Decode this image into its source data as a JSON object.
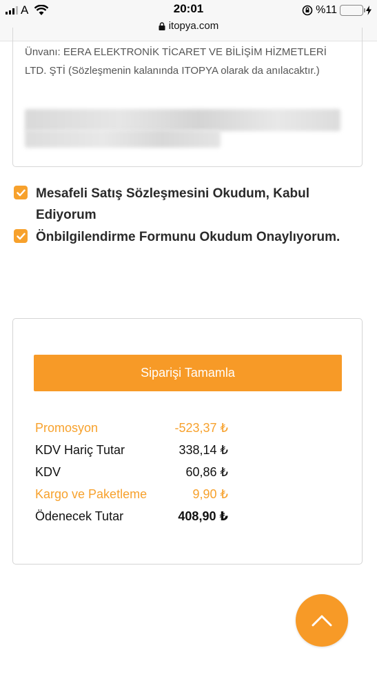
{
  "status_bar": {
    "carrier": "A",
    "time": "20:01",
    "battery_percent": "%11",
    "battery_level": 0.11,
    "url": "itopya.com"
  },
  "contract": {
    "text": "Ünvanı: EERA ELEKTRONİK TİCARET VE BİLİŞİM HİZMETLERİ LTD. ŞTİ (Sözleşmenin kalanında ITOPYA olarak da anılacaktır.)"
  },
  "agreements": [
    {
      "label": "Mesafeli Satış Sözleşmesini Okudum, Kabul Ediyorum",
      "checked": true
    },
    {
      "label": "Önbilgilendirme Formunu Okudum Onaylıyorum.",
      "checked": true
    }
  ],
  "summary": {
    "complete_button": "Siparişi Tamamla",
    "rows": [
      {
        "label": "Promosyon",
        "value": "-523,37 ₺"
      },
      {
        "label": "KDV Hariç Tutar",
        "value": "338,14 ₺"
      },
      {
        "label": "KDV",
        "value": "60,86 ₺"
      },
      {
        "label": "Kargo ve Paketleme",
        "value": "9,90 ₺"
      },
      {
        "label": "Ödenecek Tutar",
        "value": "408,90 ₺"
      }
    ]
  },
  "colors": {
    "accent": "#f79a27",
    "checkbox": "#f7a12c"
  },
  "icons": {
    "scroll_top": "chevron-up-icon"
  }
}
